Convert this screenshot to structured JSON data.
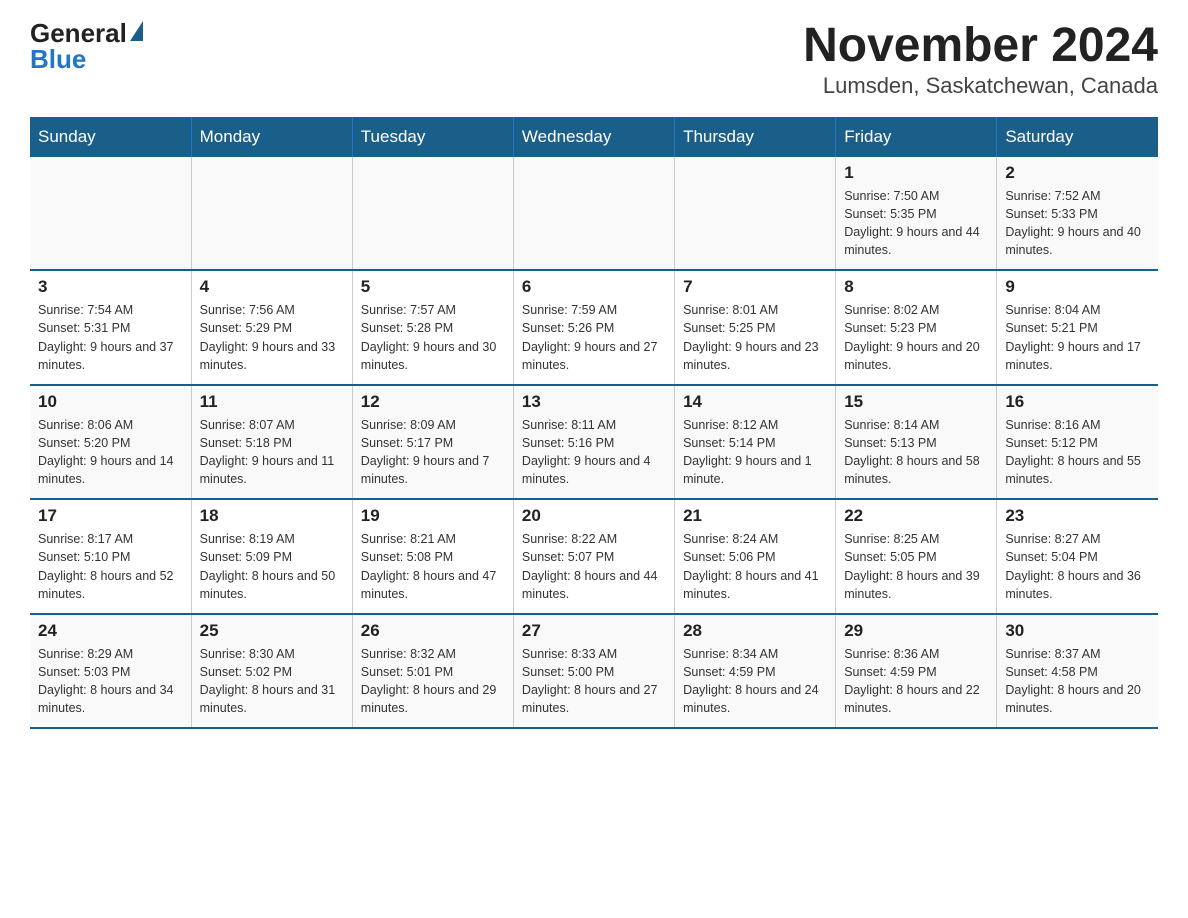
{
  "logo": {
    "general": "General",
    "blue": "Blue"
  },
  "title": "November 2024",
  "subtitle": "Lumsden, Saskatchewan, Canada",
  "days_of_week": [
    "Sunday",
    "Monday",
    "Tuesday",
    "Wednesday",
    "Thursday",
    "Friday",
    "Saturday"
  ],
  "weeks": [
    [
      {
        "num": "",
        "sunrise": "",
        "sunset": "",
        "daylight": ""
      },
      {
        "num": "",
        "sunrise": "",
        "sunset": "",
        "daylight": ""
      },
      {
        "num": "",
        "sunrise": "",
        "sunset": "",
        "daylight": ""
      },
      {
        "num": "",
        "sunrise": "",
        "sunset": "",
        "daylight": ""
      },
      {
        "num": "",
        "sunrise": "",
        "sunset": "",
        "daylight": ""
      },
      {
        "num": "1",
        "sunrise": "Sunrise: 7:50 AM",
        "sunset": "Sunset: 5:35 PM",
        "daylight": "Daylight: 9 hours and 44 minutes."
      },
      {
        "num": "2",
        "sunrise": "Sunrise: 7:52 AM",
        "sunset": "Sunset: 5:33 PM",
        "daylight": "Daylight: 9 hours and 40 minutes."
      }
    ],
    [
      {
        "num": "3",
        "sunrise": "Sunrise: 7:54 AM",
        "sunset": "Sunset: 5:31 PM",
        "daylight": "Daylight: 9 hours and 37 minutes."
      },
      {
        "num": "4",
        "sunrise": "Sunrise: 7:56 AM",
        "sunset": "Sunset: 5:29 PM",
        "daylight": "Daylight: 9 hours and 33 minutes."
      },
      {
        "num": "5",
        "sunrise": "Sunrise: 7:57 AM",
        "sunset": "Sunset: 5:28 PM",
        "daylight": "Daylight: 9 hours and 30 minutes."
      },
      {
        "num": "6",
        "sunrise": "Sunrise: 7:59 AM",
        "sunset": "Sunset: 5:26 PM",
        "daylight": "Daylight: 9 hours and 27 minutes."
      },
      {
        "num": "7",
        "sunrise": "Sunrise: 8:01 AM",
        "sunset": "Sunset: 5:25 PM",
        "daylight": "Daylight: 9 hours and 23 minutes."
      },
      {
        "num": "8",
        "sunrise": "Sunrise: 8:02 AM",
        "sunset": "Sunset: 5:23 PM",
        "daylight": "Daylight: 9 hours and 20 minutes."
      },
      {
        "num": "9",
        "sunrise": "Sunrise: 8:04 AM",
        "sunset": "Sunset: 5:21 PM",
        "daylight": "Daylight: 9 hours and 17 minutes."
      }
    ],
    [
      {
        "num": "10",
        "sunrise": "Sunrise: 8:06 AM",
        "sunset": "Sunset: 5:20 PM",
        "daylight": "Daylight: 9 hours and 14 minutes."
      },
      {
        "num": "11",
        "sunrise": "Sunrise: 8:07 AM",
        "sunset": "Sunset: 5:18 PM",
        "daylight": "Daylight: 9 hours and 11 minutes."
      },
      {
        "num": "12",
        "sunrise": "Sunrise: 8:09 AM",
        "sunset": "Sunset: 5:17 PM",
        "daylight": "Daylight: 9 hours and 7 minutes."
      },
      {
        "num": "13",
        "sunrise": "Sunrise: 8:11 AM",
        "sunset": "Sunset: 5:16 PM",
        "daylight": "Daylight: 9 hours and 4 minutes."
      },
      {
        "num": "14",
        "sunrise": "Sunrise: 8:12 AM",
        "sunset": "Sunset: 5:14 PM",
        "daylight": "Daylight: 9 hours and 1 minute."
      },
      {
        "num": "15",
        "sunrise": "Sunrise: 8:14 AM",
        "sunset": "Sunset: 5:13 PM",
        "daylight": "Daylight: 8 hours and 58 minutes."
      },
      {
        "num": "16",
        "sunrise": "Sunrise: 8:16 AM",
        "sunset": "Sunset: 5:12 PM",
        "daylight": "Daylight: 8 hours and 55 minutes."
      }
    ],
    [
      {
        "num": "17",
        "sunrise": "Sunrise: 8:17 AM",
        "sunset": "Sunset: 5:10 PM",
        "daylight": "Daylight: 8 hours and 52 minutes."
      },
      {
        "num": "18",
        "sunrise": "Sunrise: 8:19 AM",
        "sunset": "Sunset: 5:09 PM",
        "daylight": "Daylight: 8 hours and 50 minutes."
      },
      {
        "num": "19",
        "sunrise": "Sunrise: 8:21 AM",
        "sunset": "Sunset: 5:08 PM",
        "daylight": "Daylight: 8 hours and 47 minutes."
      },
      {
        "num": "20",
        "sunrise": "Sunrise: 8:22 AM",
        "sunset": "Sunset: 5:07 PM",
        "daylight": "Daylight: 8 hours and 44 minutes."
      },
      {
        "num": "21",
        "sunrise": "Sunrise: 8:24 AM",
        "sunset": "Sunset: 5:06 PM",
        "daylight": "Daylight: 8 hours and 41 minutes."
      },
      {
        "num": "22",
        "sunrise": "Sunrise: 8:25 AM",
        "sunset": "Sunset: 5:05 PM",
        "daylight": "Daylight: 8 hours and 39 minutes."
      },
      {
        "num": "23",
        "sunrise": "Sunrise: 8:27 AM",
        "sunset": "Sunset: 5:04 PM",
        "daylight": "Daylight: 8 hours and 36 minutes."
      }
    ],
    [
      {
        "num": "24",
        "sunrise": "Sunrise: 8:29 AM",
        "sunset": "Sunset: 5:03 PM",
        "daylight": "Daylight: 8 hours and 34 minutes."
      },
      {
        "num": "25",
        "sunrise": "Sunrise: 8:30 AM",
        "sunset": "Sunset: 5:02 PM",
        "daylight": "Daylight: 8 hours and 31 minutes."
      },
      {
        "num": "26",
        "sunrise": "Sunrise: 8:32 AM",
        "sunset": "Sunset: 5:01 PM",
        "daylight": "Daylight: 8 hours and 29 minutes."
      },
      {
        "num": "27",
        "sunrise": "Sunrise: 8:33 AM",
        "sunset": "Sunset: 5:00 PM",
        "daylight": "Daylight: 8 hours and 27 minutes."
      },
      {
        "num": "28",
        "sunrise": "Sunrise: 8:34 AM",
        "sunset": "Sunset: 4:59 PM",
        "daylight": "Daylight: 8 hours and 24 minutes."
      },
      {
        "num": "29",
        "sunrise": "Sunrise: 8:36 AM",
        "sunset": "Sunset: 4:59 PM",
        "daylight": "Daylight: 8 hours and 22 minutes."
      },
      {
        "num": "30",
        "sunrise": "Sunrise: 8:37 AM",
        "sunset": "Sunset: 4:58 PM",
        "daylight": "Daylight: 8 hours and 20 minutes."
      }
    ]
  ]
}
